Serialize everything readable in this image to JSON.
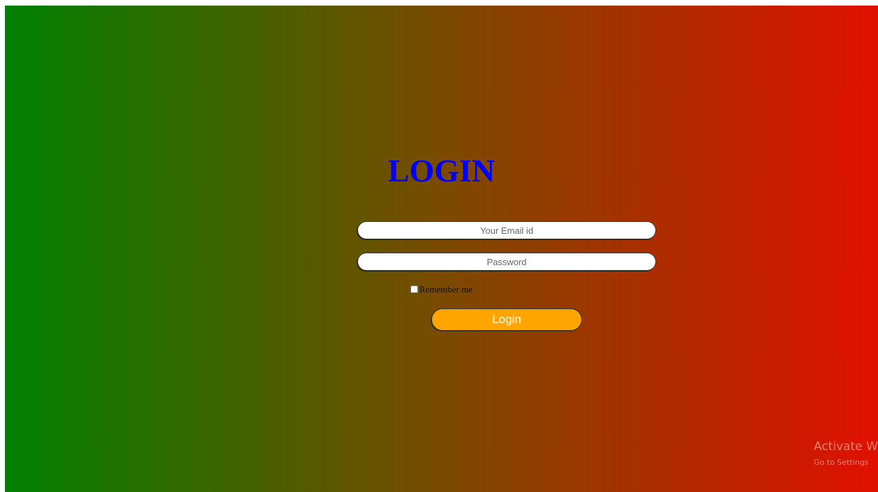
{
  "login": {
    "title": "LOGIN",
    "email_placeholder": "Your Email id",
    "password_placeholder": "Password",
    "remember_label": "Remember me",
    "remember_checked": false,
    "button_label": "Login"
  },
  "colors": {
    "gradient_start": "#008000",
    "gradient_end": "#e01000",
    "title": "#0000ff",
    "button": "#ffa500"
  },
  "watermark": {
    "title": "Activate W",
    "subtitle": "Go to Settings"
  }
}
